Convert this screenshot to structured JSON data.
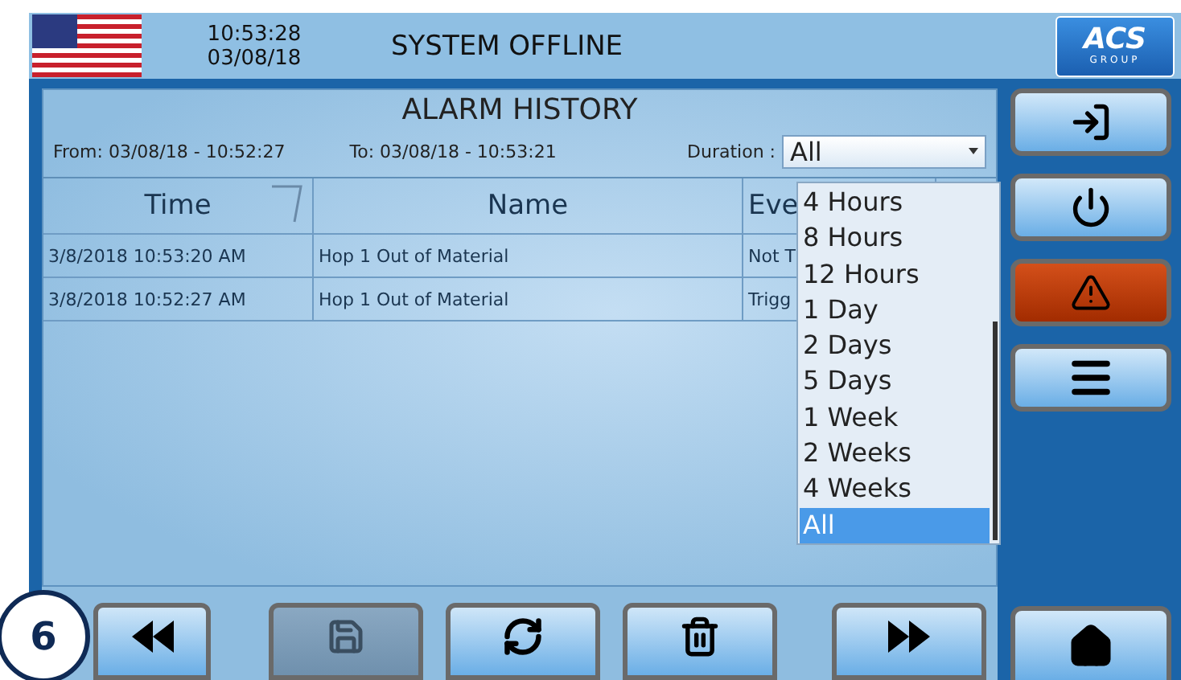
{
  "header": {
    "time": "10:53:28",
    "date": "03/08/18",
    "status": "SYSTEM OFFLINE",
    "logo": {
      "name": "ACS",
      "tagline": "GROUP"
    }
  },
  "panel": {
    "title": "ALARM HISTORY",
    "from_label": "From:",
    "from_value": "03/08/18 - 10:52:27",
    "to_label": "To:",
    "to_value": "03/08/18 - 10:53:21",
    "duration_label": "Duration :",
    "duration_value": "All"
  },
  "table": {
    "columns": [
      "Time",
      "Name",
      "Eve"
    ],
    "rows": [
      [
        "3/8/2018 10:53:20 AM",
        "Hop 1 Out of Material",
        "Not T"
      ],
      [
        "3/8/2018 10:52:27 AM",
        "Hop 1 Out of Material",
        "Trigg"
      ]
    ]
  },
  "duration_options": [
    {
      "label": "4 Hours",
      "selected": false
    },
    {
      "label": "8 Hours",
      "selected": false
    },
    {
      "label": "12 Hours",
      "selected": false
    },
    {
      "label": "1 Day",
      "selected": false
    },
    {
      "label": "2 Days",
      "selected": false
    },
    {
      "label": "5 Days",
      "selected": false
    },
    {
      "label": "1 Week",
      "selected": false
    },
    {
      "label": "2 Weeks",
      "selected": false
    },
    {
      "label": "4 Weeks",
      "selected": false
    },
    {
      "label": "All",
      "selected": true
    }
  ],
  "side_buttons": [
    {
      "kind": "login",
      "alert": false
    },
    {
      "kind": "power",
      "alert": false
    },
    {
      "kind": "warning",
      "alert": true
    },
    {
      "kind": "menu",
      "alert": false
    }
  ],
  "bottom_buttons": [
    {
      "kind": "rewind",
      "disabled": false
    },
    {
      "kind": "save",
      "disabled": true
    },
    {
      "kind": "refresh",
      "disabled": false
    },
    {
      "kind": "delete",
      "disabled": false
    },
    {
      "kind": "forward",
      "disabled": false
    }
  ],
  "home_button": {
    "kind": "home"
  },
  "step_badge": "6"
}
